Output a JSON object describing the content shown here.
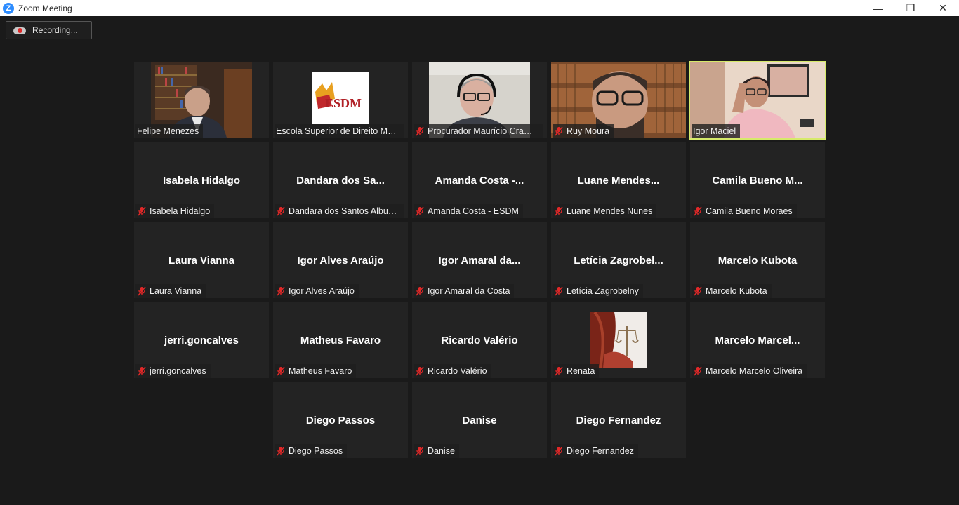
{
  "window": {
    "title": "Zoom Meeting",
    "logo_letter": "Z",
    "minimize": "—",
    "restore": "❐",
    "close": "✕"
  },
  "recording": {
    "label": "Recording..."
  },
  "colors": {
    "active_speaker": "#d6ea6a",
    "muted_icon": "#e02828",
    "tile_bg": "#232323"
  },
  "participants": {
    "felipe": {
      "name": "Felipe Menezes",
      "muted": false,
      "video": true
    },
    "escola": {
      "name": "Escola Superior de Direito Mu…",
      "logo_text": "ESDM",
      "muted": false,
      "video": true
    },
    "procurador": {
      "name": "Procurador Maurício Cram…",
      "muted": true,
      "video": true
    },
    "ruy": {
      "name": "Ruy Moura",
      "muted": true,
      "video": true
    },
    "igor_maciel": {
      "name": "Igor Maciel",
      "muted": false,
      "video": true,
      "active": true
    },
    "isabela": {
      "big": "Isabela Hidalgo",
      "name": "Isabela Hidalgo",
      "muted": true
    },
    "dandara": {
      "big": "Dandara dos Sa...",
      "name": "Dandara dos Santos Albuq…",
      "muted": true
    },
    "amanda": {
      "big": "Amanda Costa -...",
      "name": "Amanda Costa - ESDM",
      "muted": true
    },
    "luane": {
      "big": "Luane Mendes...",
      "name": "Luane Mendes Nunes",
      "muted": true
    },
    "camila": {
      "big": "Camila Bueno M...",
      "name": "Camila Bueno Moraes",
      "muted": true
    },
    "laura": {
      "big": "Laura Vianna",
      "name": "Laura Vianna",
      "muted": true
    },
    "igor_alves": {
      "big": "Igor Alves Araújo",
      "name": "Igor Alves Araújo",
      "muted": true
    },
    "igor_amaral": {
      "big": "Igor Amaral da...",
      "name": "Igor Amaral da Costa",
      "muted": true
    },
    "leticia": {
      "big": "Letícia Zagrobel...",
      "name": "Letícia Zagrobelny",
      "muted": true
    },
    "marcelo_k": {
      "big": "Marcelo Kubota",
      "name": "Marcelo Kubota",
      "muted": true
    },
    "jerri": {
      "big": "jerri.goncalves",
      "name": "jerri.goncalves",
      "muted": true
    },
    "matheus": {
      "big": "Matheus Favaro",
      "name": "Matheus Favaro",
      "muted": true
    },
    "ricardo": {
      "big": "Ricardo Valério",
      "name": "Ricardo Valério",
      "muted": true
    },
    "renata": {
      "name": "Renata",
      "muted": true,
      "avatar": true
    },
    "marcelo_o": {
      "big": "Marcelo Marcel...",
      "name": "Marcelo Marcelo Oliveira",
      "muted": true
    },
    "diego_p": {
      "big": "Diego Passos",
      "name": "Diego Passos",
      "muted": true
    },
    "danise": {
      "big": "Danise",
      "name": "Danise",
      "muted": true
    },
    "diego_f": {
      "big": "Diego Fernandez",
      "name": "Diego Fernandez",
      "muted": true
    }
  }
}
